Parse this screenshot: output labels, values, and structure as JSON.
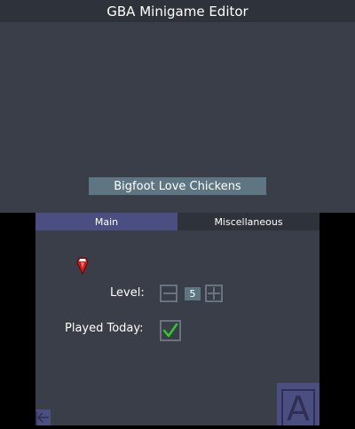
{
  "top_screen": {
    "title": "GBA Minigame Editor",
    "game_name": "Bigfoot Love Chickens"
  },
  "tabs": [
    {
      "label": "Main",
      "active": true
    },
    {
      "label": "Miscellaneous",
      "active": false
    }
  ],
  "form": {
    "level_label": "Level:",
    "level_value": "5",
    "played_today_label": "Played Today:",
    "played_today_checked": true
  },
  "buttons": {
    "a_label": "A"
  },
  "icons": {
    "gem": "red-gem-icon",
    "minus": "minus-icon",
    "plus": "plus-icon",
    "check": "checkmark-icon",
    "back": "back-arrow-icon"
  },
  "colors": {
    "background": "#3a3e49",
    "title_bar": "#2e323b",
    "accent_tab": "#4a4e80",
    "field": "#5e7682",
    "check": "#2ec82e",
    "gem": "#d01818"
  }
}
